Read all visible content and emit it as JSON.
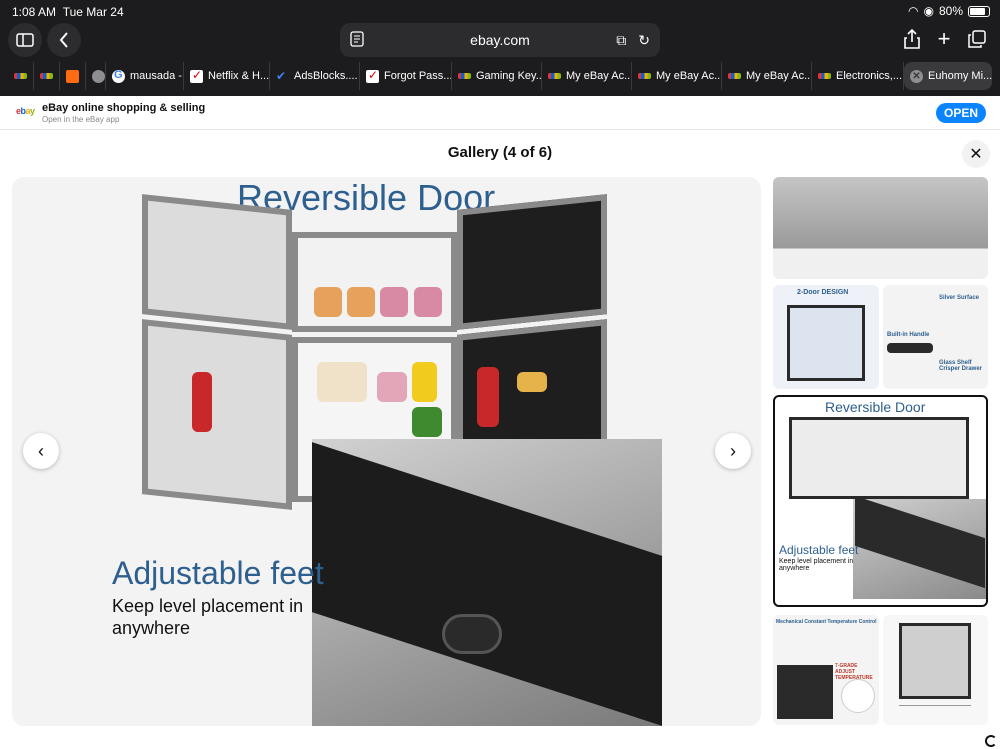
{
  "status_bar": {
    "time": "1:08 AM",
    "date": "Tue Mar 24",
    "battery": "80%"
  },
  "browser": {
    "url": "ebay.com",
    "tabs": [
      {
        "label": "",
        "favicon": "ebay"
      },
      {
        "label": "",
        "favicon": "ebay"
      },
      {
        "label": "",
        "favicon": "orange"
      },
      {
        "label": "",
        "favicon": "gray"
      },
      {
        "label": "mausada -...",
        "favicon": "google"
      },
      {
        "label": "Netflix & H...",
        "favicon": "check"
      },
      {
        "label": "AdsBlocks....",
        "favicon": "blue"
      },
      {
        "label": "Forgot Pass...",
        "favicon": "check"
      },
      {
        "label": "Gaming Key...",
        "favicon": "ebay"
      },
      {
        "label": "My eBay Ac...",
        "favicon": "ebay"
      },
      {
        "label": "My eBay Ac...",
        "favicon": "ebay"
      },
      {
        "label": "My eBay Ac...",
        "favicon": "ebay"
      },
      {
        "label": "Electronics,...",
        "favicon": "ebay"
      },
      {
        "label": "Euhomy Mi...",
        "favicon": "close",
        "active": true
      }
    ]
  },
  "app_banner": {
    "logo": {
      "e": "e",
      "b": "b",
      "a": "a",
      "y": "y"
    },
    "title": "eBay online shopping & selling",
    "subtitle": "Open in the eBay app",
    "open_label": "OPEN"
  },
  "gallery": {
    "title": "Gallery (4 of 6)",
    "main_image": {
      "headline": "Reversible Door",
      "feature_title": "Adjustable feet",
      "feature_text": "Keep level placement in anywhere"
    },
    "thumbnails": [
      {
        "caption": ""
      },
      {
        "caption_left": "2-Door DESIGN",
        "caption_right_1": "Silver Surface",
        "caption_right_2": "Built-in Handle",
        "caption_right_3": "Glass Shelf Crisper Drawer"
      },
      {
        "caption": "Reversible Door",
        "caption_2": "Adjustable feet",
        "caption_3": "Keep level placement in anywhere",
        "selected": true
      },
      {
        "caption": "Mechanical Constant Temperature Control",
        "caption_2": "7-GRADE ADJUST TEMPERATURE"
      },
      {
        "caption": ""
      }
    ]
  },
  "colors": {
    "chrome": "#1c1c1e",
    "accent": "#0a84ff",
    "headline_blue": "#2d5f8f"
  },
  "icons": [
    "sidebar-icon",
    "back-icon",
    "reader-icon",
    "extensions-icon",
    "reload-icon",
    "share-icon",
    "plus-icon",
    "tabs-icon",
    "close-icon",
    "chevron-left-icon",
    "chevron-right-icon"
  ]
}
